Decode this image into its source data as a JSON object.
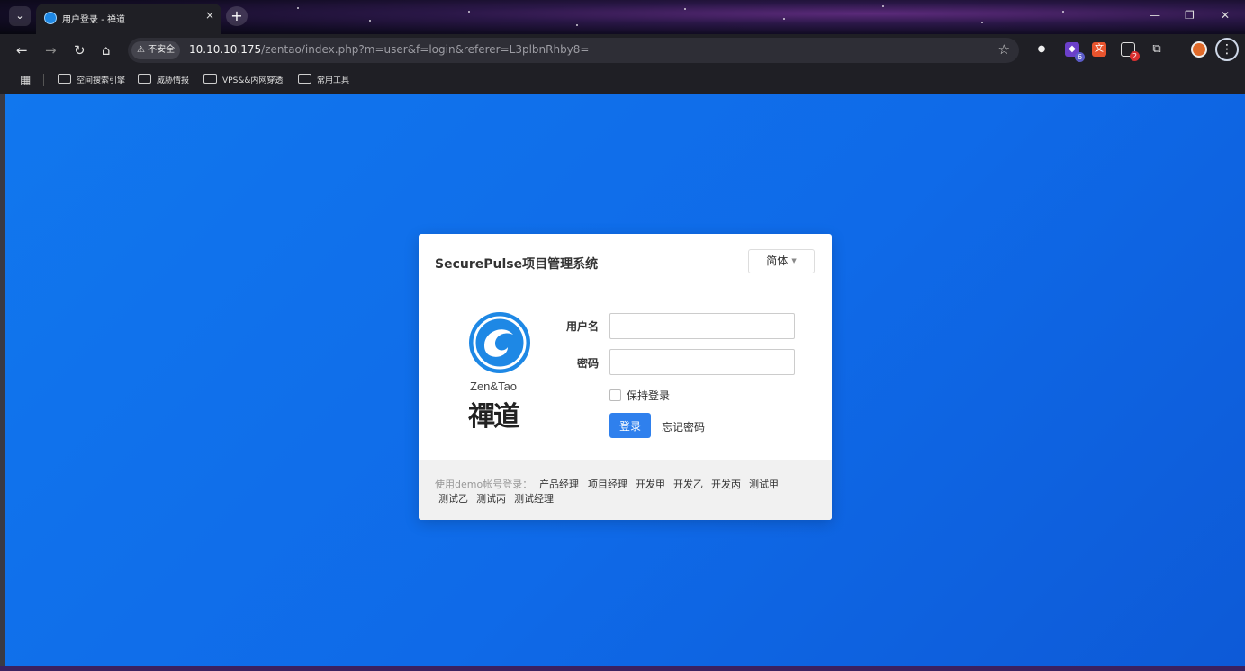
{
  "browser": {
    "tab_title": "用户登录 - 禅道",
    "tab_close": "×",
    "new_tab": "+",
    "tab_menu": "⌄",
    "security_label": "⚠ 不安全",
    "url_host": "10.10.10.175",
    "url_path": "/zentao/index.php?m=user&f=login&referer=L3plbnRhby8=",
    "extensions": [
      {
        "name": "puzzle-ext",
        "badge": ""
      },
      {
        "name": "purple-ext",
        "badge": "6"
      },
      {
        "name": "translate-ext",
        "badge": ""
      },
      {
        "name": "screen-ext",
        "badge": "2"
      }
    ],
    "bookmarks": [
      "空间搜索引擎",
      "威胁情报",
      "VPS&&内网穿透",
      "常用工具"
    ]
  },
  "login": {
    "system_title": "SecurePulse项目管理系统",
    "language": "简体",
    "logo_en": "Zen&Tao",
    "logo_cn": "禪道",
    "username_label": "用户名",
    "username_value": "",
    "password_label": "密码",
    "password_value": "",
    "remember_label": "保持登录",
    "submit_label": "登录",
    "forgot_label": "忘记密码",
    "demo_prefix": "使用demo帐号登录：",
    "demo_accounts": [
      "产品经理",
      "项目经理",
      "开发甲",
      "开发乙",
      "开发丙",
      "测试甲",
      "测试乙",
      "测试丙",
      "测试经理"
    ]
  },
  "colors": {
    "page_bg": "#1177ee",
    "primary_button": "#2f80ed",
    "logo_blue": "#1e88e5"
  }
}
